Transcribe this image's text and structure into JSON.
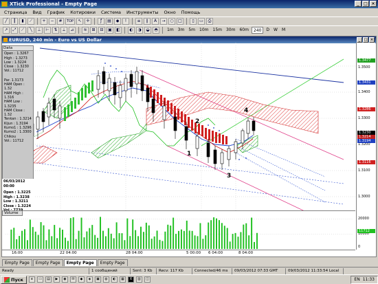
{
  "window": {
    "title": "XTick Professional - Empty Page",
    "buttons": [
      "_",
      "□",
      "×"
    ]
  },
  "menu": [
    "Страница",
    "Вид",
    "График",
    "Котировки",
    "Система",
    "Инструменты",
    "Окно",
    "Помощь"
  ],
  "toolbar": {
    "timeframes": [
      "1m",
      "3m",
      "5m",
      "10m",
      "15m",
      "30m",
      "60m",
      "240",
      "D",
      "W",
      "M"
    ],
    "top_label": "TOP"
  },
  "chart": {
    "window_title": "EURUSD, 240 min - Euro vs US Dollar",
    "data_panel": {
      "title": "Data",
      "lines_a": [
        "Open : 1.3267",
        "High : 1.3273",
        "Low : 1.3224",
        "Close : 1.3230",
        "Vol.: 11712"
      ],
      "lines_b": [
        "Par. 1.3173",
        "HAM Open : 1.32",
        "HAM High : 1.316",
        "HAM Low : 1.3235",
        "HAM Close : 1.32",
        "Tenkan : 1.3214",
        "Kijun : 1.3194",
        "Kumo1 : 1.3296",
        "Kumo2 : 1.3300",
        "Chikou",
        "Vol.: 11712"
      ]
    },
    "cursor_panel": {
      "date": "06/03/2012 00:00",
      "lines": [
        "Open : 1.3225",
        "High : 1.3238",
        "Low : 1.3211",
        "Close : 1.3224",
        "Vol.: 7739"
      ]
    },
    "y_ticks": [
      "1.3500",
      "1.3400",
      "1.3300",
      "1.3200",
      "1.3100",
      "1.3000"
    ],
    "y_tags": [
      {
        "label": "1.3477",
        "color": "#20a020"
      },
      {
        "label": "1.3431",
        "color": "#2040c0"
      },
      {
        "label": "1.3286",
        "color": "#d02020"
      },
      {
        "label": "1.3230",
        "color": "#000000"
      },
      {
        "label": "1.3214",
        "color": "#c02020"
      },
      {
        "label": "1.3194",
        "color": "#2040c0"
      },
      {
        "label": "1.3116",
        "color": "#d02020"
      }
    ],
    "wave_labels": [
      "1",
      "2",
      "3",
      "4"
    ],
    "volume_title": "Volume",
    "volume_ticks": [
      "20000",
      "10000",
      "0"
    ],
    "volume_tag": "11712",
    "x_ticks": [
      "16:00",
      "22 04:00",
      "28 04:00",
      "5 00:00",
      "6 04:00",
      "8 04:00"
    ]
  },
  "tabs": [
    "Empty Page",
    "Empty Page",
    "Empty Page",
    "Empty Page"
  ],
  "active_tab_index": 2,
  "status": {
    "ready": "Ready",
    "messages": "1 сообщений",
    "sent": "Sent: 3 Kb",
    "recv": "Recv: 117 Kb",
    "connected": "Connected/46 ms",
    "gmt": "09/03/2012 07:33 GMT",
    "local": "09/03/2012 11:33:54 Local"
  },
  "taskbar": {
    "start": "Пуск",
    "lang": "EN",
    "clock": "11:33"
  }
}
